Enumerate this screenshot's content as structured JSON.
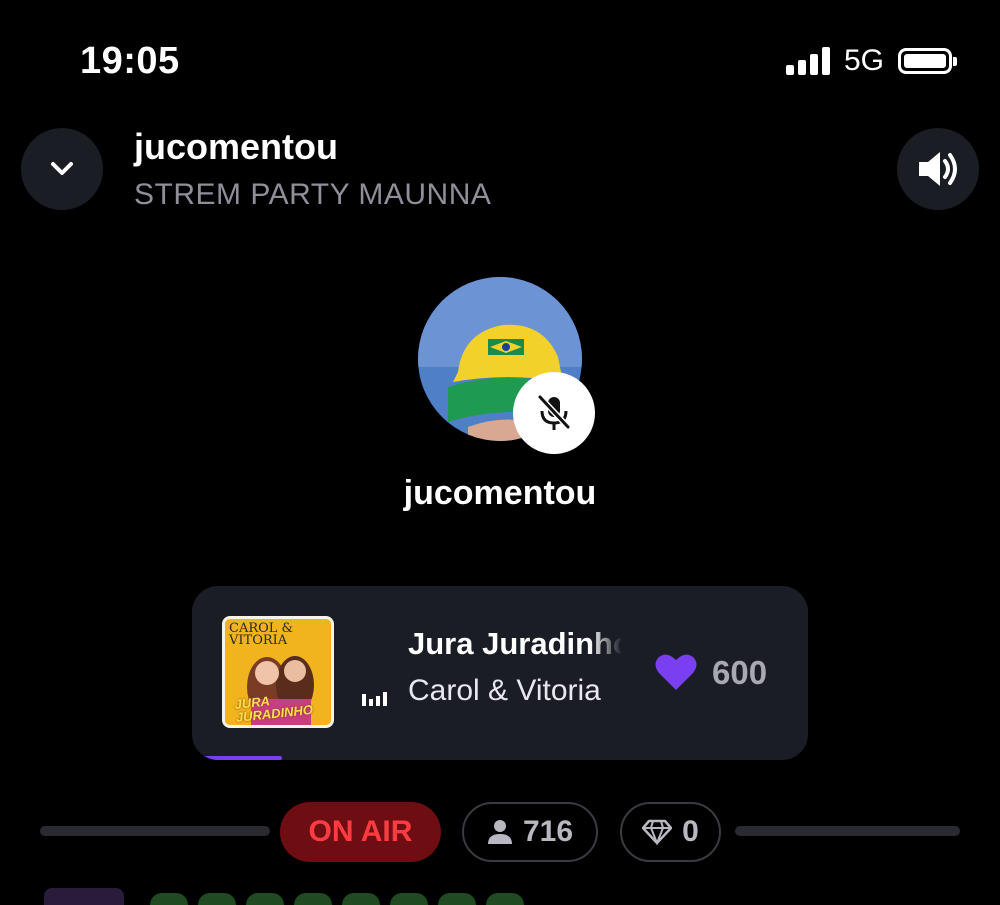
{
  "status_bar": {
    "time": "19:05",
    "network": "5G"
  },
  "header": {
    "title": "jucomentou",
    "subtitle": "STREM PARTY MAUNNA"
  },
  "host": {
    "name": "jucomentou",
    "muted": true
  },
  "now_playing": {
    "album_text_top": "CAROL & VITORIA",
    "album_text_bottom": "JURA JURADINHO",
    "title": "Jura Juradinho",
    "artist": "Carol & Vitoria",
    "likes": "600",
    "progress_fraction": 0.13
  },
  "stats": {
    "on_air_label": "ON AIR",
    "listeners": "716",
    "gems": "0"
  },
  "colors": {
    "accent_purple": "#7b3ff2",
    "on_air_bg": "#6e0e12",
    "on_air_text": "#ff3b42",
    "card_bg": "#1b1d26"
  }
}
